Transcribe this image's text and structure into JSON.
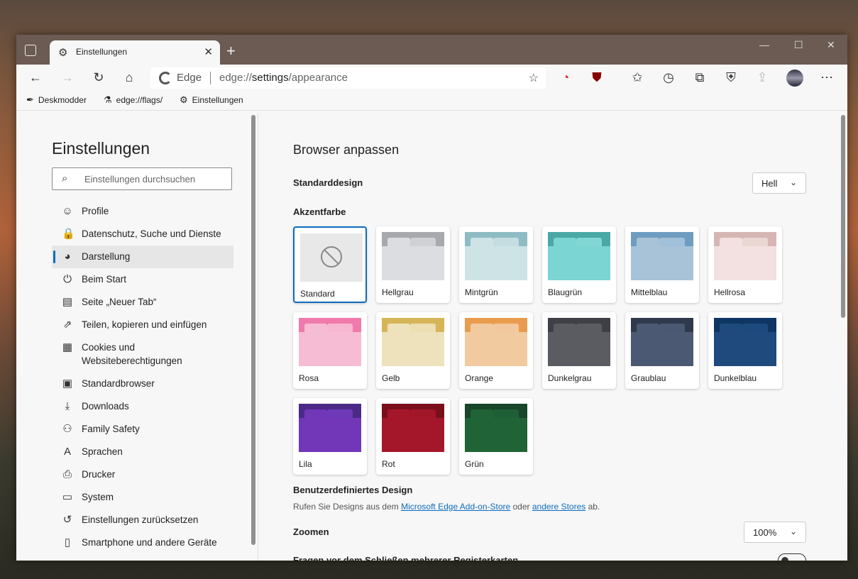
{
  "window": {
    "tab_title": "Einstellungen",
    "address": {
      "brand": "Edge",
      "url_prefix": "edge://",
      "url_path": "settings",
      "url_suffix": "/appearance"
    }
  },
  "bookmarks": [
    {
      "label": "Deskmodder",
      "icon": "feather-icon"
    },
    {
      "label": "edge://flags/",
      "icon": "flask-icon"
    },
    {
      "label": "Einstellungen",
      "icon": "gear-icon"
    }
  ],
  "sidebar": {
    "title": "Einstellungen",
    "search_placeholder": "Einstellungen durchsuchen",
    "items": [
      {
        "label": "Profile",
        "icon": "profile-icon"
      },
      {
        "label": "Datenschutz, Suche und Dienste",
        "icon": "lock-icon"
      },
      {
        "label": "Darstellung",
        "icon": "palette-icon",
        "active": true
      },
      {
        "label": "Beim Start",
        "icon": "power-icon"
      },
      {
        "label": "Seite „Neuer Tab“",
        "icon": "newtab-icon"
      },
      {
        "label": "Teilen, kopieren und einfügen",
        "icon": "share-icon"
      },
      {
        "label": "Cookies und Websiteberechtigungen",
        "icon": "cookie-icon"
      },
      {
        "label": "Standardbrowser",
        "icon": "browser-icon"
      },
      {
        "label": "Downloads",
        "icon": "download-icon"
      },
      {
        "label": "Family Safety",
        "icon": "family-icon"
      },
      {
        "label": "Sprachen",
        "icon": "language-icon"
      },
      {
        "label": "Drucker",
        "icon": "printer-icon"
      },
      {
        "label": "System",
        "icon": "laptop-icon"
      },
      {
        "label": "Einstellungen zurücksetzen",
        "icon": "reset-icon"
      },
      {
        "label": "Smartphone und andere Geräte",
        "icon": "phone-icon"
      }
    ]
  },
  "main": {
    "title": "Browser anpassen",
    "theme_label": "Standarddesign",
    "theme_value": "Hell",
    "accent_label": "Akzentfarbe",
    "swatches": [
      {
        "name": "Standard",
        "selected": true
      },
      {
        "name": "Hellgrau",
        "top": "#a7a9ad",
        "tab": "#cfd1d4",
        "body": "#dcdde0"
      },
      {
        "name": "Mintgrün",
        "top": "#8fbcc4",
        "tab": "#c5dde1",
        "body": "#cde3e6"
      },
      {
        "name": "Blaugrün",
        "top": "#4aa9a5",
        "tab": "#82d7d4",
        "body": "#7ad5d3"
      },
      {
        "name": "Mittelblau",
        "top": "#6f9cc1",
        "tab": "#a1c0da",
        "body": "#a8c3d8"
      },
      {
        "name": "Hellrosa",
        "top": "#d6b6b3",
        "tab": "#ead6d3",
        "body": "#f2e1e0"
      },
      {
        "name": "Rosa",
        "top": "#ef7aab",
        "tab": "#f7b7d0",
        "body": "#f6bcd3"
      },
      {
        "name": "Gelb",
        "top": "#d6b558",
        "tab": "#eedfb2",
        "body": "#eee2bd"
      },
      {
        "name": "Orange",
        "top": "#e99c4e",
        "tab": "#f3c89e",
        "body": "#f2caa0"
      },
      {
        "name": "Dunkelgrau",
        "top": "#3e4045",
        "tab": "#5a5c61",
        "body": "#5a5c62"
      },
      {
        "name": "Graublau",
        "top": "#2f3a4c",
        "tab": "#4a5871",
        "body": "#4b5a72"
      },
      {
        "name": "Dunkelblau",
        "top": "#0f3663",
        "tab": "#1d4a7e",
        "body": "#1e4a7d"
      },
      {
        "name": "Lila",
        "top": "#4b2a87",
        "tab": "#6f3ab8",
        "body": "#7237b8"
      },
      {
        "name": "Rot",
        "top": "#7a0f1c",
        "tab": "#a2162a",
        "body": "#a4172b"
      },
      {
        "name": "Grün",
        "top": "#17462a",
        "tab": "#1f5f36",
        "body": "#206336"
      }
    ],
    "custom_label": "Benutzerdefiniertes Design",
    "custom_text_1": "Rufen Sie Designs aus dem ",
    "custom_link_1": "Microsoft Edge Add-on-Store",
    "custom_text_2": " oder ",
    "custom_link_2": "andere Stores",
    "custom_text_3": " ab.",
    "zoom_label": "Zoomen",
    "zoom_value": "100%",
    "cut_label": "Fragen vor dem Schließen mehrerer Registerkarten"
  },
  "colors": {
    "accent": "#0f6cbd"
  }
}
